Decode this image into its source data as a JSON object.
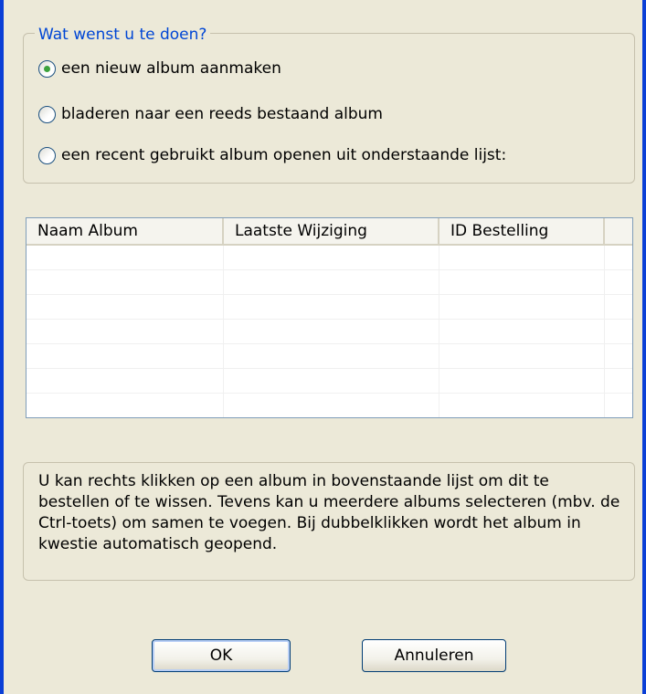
{
  "options_group": {
    "legend": "Wat wenst u te doen?",
    "options": [
      {
        "label": "een nieuw album aanmaken",
        "checked": true
      },
      {
        "label": "bladeren naar een reeds bestaand album",
        "checked": false
      },
      {
        "label": "een recent gebruikt album openen uit onderstaande lijst:",
        "checked": false
      }
    ]
  },
  "album_list": {
    "columns": [
      "Naam Album",
      "Laatste Wijziging",
      "ID Bestelling"
    ],
    "rows": []
  },
  "info": {
    "text": "U kan rechts klikken op een album in bovenstaande lijst om dit te bestellen of te wissen. Tevens kan u meerdere albums selecteren (mbv. de Ctrl-toets) om samen te voegen. Bij dubbelklikken wordt het album in kwestie automatisch geopend."
  },
  "buttons": {
    "ok": "OK",
    "cancel": "Annuleren"
  },
  "colors": {
    "dialog_background": "#ece9d8",
    "legend_text": "#0046d5",
    "window_border": "#0a3fd6",
    "radio_selected": "#3ca23c"
  }
}
